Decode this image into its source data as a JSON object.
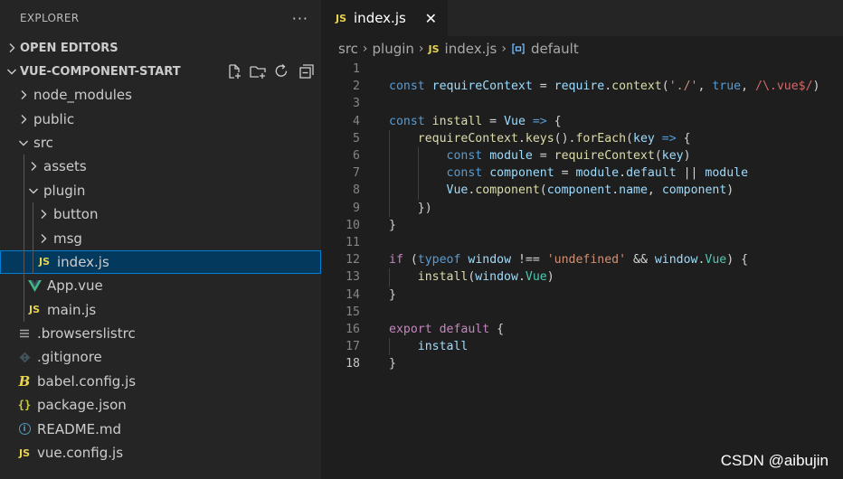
{
  "explorer": {
    "title": "EXPLORER",
    "more": "···",
    "open_editors": "OPEN EDITORS",
    "project": "VUE-COMPONENT-START",
    "tree": [
      {
        "label": "node_modules",
        "type": "folder",
        "expanded": false,
        "depth": 0
      },
      {
        "label": "public",
        "type": "folder",
        "expanded": false,
        "depth": 0
      },
      {
        "label": "src",
        "type": "folder",
        "expanded": true,
        "depth": 0
      },
      {
        "label": "assets",
        "type": "folder",
        "expanded": false,
        "depth": 1
      },
      {
        "label": "plugin",
        "type": "folder",
        "expanded": true,
        "depth": 1
      },
      {
        "label": "button",
        "type": "folder",
        "expanded": false,
        "depth": 2
      },
      {
        "label": "msg",
        "type": "folder",
        "expanded": false,
        "depth": 2
      },
      {
        "label": "index.js",
        "type": "js",
        "depth": 2,
        "selected": true
      },
      {
        "label": "App.vue",
        "type": "vue",
        "depth": 1
      },
      {
        "label": "main.js",
        "type": "js",
        "depth": 1
      },
      {
        "label": ".browserslistrc",
        "type": "lines",
        "depth": 0
      },
      {
        "label": ".gitignore",
        "type": "git",
        "depth": 0
      },
      {
        "label": "babel.config.js",
        "type": "babel",
        "depth": 0
      },
      {
        "label": "package.json",
        "type": "json",
        "depth": 0
      },
      {
        "label": "README.md",
        "type": "info",
        "depth": 0
      },
      {
        "label": "vue.config.js",
        "type": "js",
        "depth": 0
      }
    ]
  },
  "editor": {
    "tab": {
      "label": "index.js",
      "badge": "JS",
      "close": "✕"
    },
    "breadcrumb": {
      "parts": [
        "src",
        "plugin"
      ],
      "file": "index.js",
      "symbol": "default"
    },
    "active_line": 18,
    "lines": [
      [],
      [
        [
          "kw",
          "const"
        ],
        [
          "pl",
          " "
        ],
        [
          "var",
          "requireContext"
        ],
        [
          "pl",
          " = "
        ],
        [
          "var",
          "require"
        ],
        [
          "pl",
          "."
        ],
        [
          "fn",
          "context"
        ],
        [
          "pl",
          "("
        ],
        [
          "str",
          "'./'"
        ],
        [
          "pl",
          ", "
        ],
        [
          "kw",
          "true"
        ],
        [
          "pl",
          ", "
        ],
        [
          "rx",
          "/\\.vue$/"
        ],
        [
          "pl",
          ")"
        ]
      ],
      [],
      [
        [
          "kw",
          "const"
        ],
        [
          "pl",
          " "
        ],
        [
          "fn",
          "install"
        ],
        [
          "pl",
          " = "
        ],
        [
          "var",
          "Vue"
        ],
        [
          "pl",
          " "
        ],
        [
          "kw",
          "=>"
        ],
        [
          "pl",
          " {"
        ]
      ],
      [
        [
          "pl",
          "    "
        ],
        [
          "fn",
          "requireContext"
        ],
        [
          "pl",
          "."
        ],
        [
          "fn",
          "keys"
        ],
        [
          "pl",
          "()."
        ],
        [
          "fn",
          "forEach"
        ],
        [
          "pl",
          "("
        ],
        [
          "var",
          "key"
        ],
        [
          "pl",
          " "
        ],
        [
          "kw",
          "=>"
        ],
        [
          "pl",
          " {"
        ]
      ],
      [
        [
          "pl",
          "        "
        ],
        [
          "kw",
          "const"
        ],
        [
          "pl",
          " "
        ],
        [
          "var",
          "module"
        ],
        [
          "pl",
          " = "
        ],
        [
          "fn",
          "requireContext"
        ],
        [
          "pl",
          "("
        ],
        [
          "var",
          "key"
        ],
        [
          "pl",
          ")"
        ]
      ],
      [
        [
          "pl",
          "        "
        ],
        [
          "kw",
          "const"
        ],
        [
          "pl",
          " "
        ],
        [
          "var",
          "component"
        ],
        [
          "pl",
          " = "
        ],
        [
          "var",
          "module"
        ],
        [
          "pl",
          "."
        ],
        [
          "var",
          "default"
        ],
        [
          "pl",
          " || "
        ],
        [
          "var",
          "module"
        ]
      ],
      [
        [
          "pl",
          "        "
        ],
        [
          "var",
          "Vue"
        ],
        [
          "pl",
          "."
        ],
        [
          "fn",
          "component"
        ],
        [
          "pl",
          "("
        ],
        [
          "var",
          "component"
        ],
        [
          "pl",
          "."
        ],
        [
          "var",
          "name"
        ],
        [
          "pl",
          ", "
        ],
        [
          "var",
          "component"
        ],
        [
          "pl",
          ")"
        ]
      ],
      [
        [
          "pl",
          "    })"
        ]
      ],
      [
        [
          "pl",
          "}"
        ]
      ],
      [],
      [
        [
          "kw2",
          "if"
        ],
        [
          "pl",
          " ("
        ],
        [
          "kw",
          "typeof"
        ],
        [
          "pl",
          " "
        ],
        [
          "var",
          "window"
        ],
        [
          "pl",
          " !== "
        ],
        [
          "str",
          "'undefined'"
        ],
        [
          "pl",
          " && "
        ],
        [
          "var",
          "window"
        ],
        [
          "pl",
          "."
        ],
        [
          "cls",
          "Vue"
        ],
        [
          "pl",
          ") {"
        ]
      ],
      [
        [
          "pl",
          "    "
        ],
        [
          "fn",
          "install"
        ],
        [
          "pl",
          "("
        ],
        [
          "var",
          "window"
        ],
        [
          "pl",
          "."
        ],
        [
          "cls",
          "Vue"
        ],
        [
          "pl",
          ")"
        ]
      ],
      [
        [
          "pl",
          "}"
        ]
      ],
      [],
      [
        [
          "kw2",
          "export"
        ],
        [
          "pl",
          " "
        ],
        [
          "kw2",
          "default"
        ],
        [
          "pl",
          " {"
        ]
      ],
      [
        [
          "pl",
          "    "
        ],
        [
          "var",
          "install"
        ]
      ],
      [
        [
          "pl",
          "}"
        ]
      ]
    ]
  },
  "watermark": "CSDN @aibujin"
}
